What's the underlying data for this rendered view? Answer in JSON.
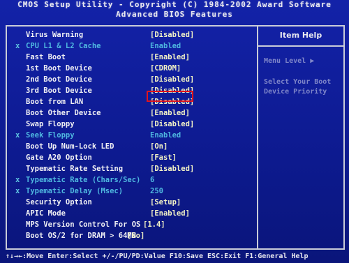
{
  "header": {
    "line1": "CMOS Setup Utility - Copyright (C) 1984-2002 Award Software",
    "line2": "Advanced BIOS Features"
  },
  "help_panel": {
    "title": "Item Help",
    "menu_level": "Menu Level   ▶",
    "text_line1": "Select Your Boot",
    "text_line2": "Device Priority"
  },
  "settings": [
    {
      "mark": "",
      "label": "Virus Warning",
      "value": "[Disabled]",
      "disabled": false
    },
    {
      "mark": "x",
      "label": "CPU L1 & L2 Cache",
      "value": "Enabled",
      "disabled": true
    },
    {
      "mark": "",
      "label": "Fast Boot",
      "value": "[Enabled]",
      "disabled": false
    },
    {
      "mark": "",
      "label": "1st Boot Device",
      "value": "[CDROM]",
      "disabled": false
    },
    {
      "mark": "",
      "label": "2nd Boot Device",
      "value": "[Disabled]",
      "disabled": false
    },
    {
      "mark": "",
      "label": "3rd Boot Device",
      "value": "[Disabled]",
      "disabled": false
    },
    {
      "mark": "",
      "label": "Boot from LAN",
      "value": "[Disabled]",
      "disabled": false
    },
    {
      "mark": "",
      "label": "Boot Other Device",
      "value": "[Enabled]",
      "disabled": false
    },
    {
      "mark": "",
      "label": "Swap Floppy",
      "value": "[Disabled]",
      "disabled": false
    },
    {
      "mark": "x",
      "label": "Seek Floppy",
      "value": "Enabled",
      "disabled": true
    },
    {
      "mark": "",
      "label": "Boot Up Num-Lock LED",
      "value": "[On]",
      "disabled": false
    },
    {
      "mark": "",
      "label": "Gate A20 Option",
      "value": "[Fast]",
      "disabled": false
    },
    {
      "mark": "",
      "label": "Typematic Rate Setting",
      "value": "[Disabled]",
      "disabled": false
    },
    {
      "mark": "x",
      "label": "Typematic Rate (Chars/Sec)",
      "value": "6",
      "disabled": true
    },
    {
      "mark": "x",
      "label": "Typematic Delay (Msec)",
      "value": "250",
      "disabled": true
    },
    {
      "mark": "",
      "label": "Security Option",
      "value": "[Setup]",
      "disabled": false
    },
    {
      "mark": "",
      "label": "APIC Mode",
      "value": "[Enabled]",
      "disabled": false
    },
    {
      "mark": "",
      "label": "MPS Version Control For OS",
      "value": "[1.4]",
      "disabled": false
    },
    {
      "mark": "",
      "label": "Boot OS/2 for DRAM > 64MB",
      "value": "[No]",
      "disabled": false
    }
  ],
  "footer": {
    "text": "↑↓→←:Move  Enter:Select  +/-/PU/PD:Value  F10:Save  ESC:Exit  F1:General Help"
  },
  "colors": {
    "background": "#0e1a8a",
    "text": "#f0f0f4",
    "value": "#f4f4c6",
    "disabled": "#4fb8e0",
    "highlight_box": "#e0141c"
  }
}
